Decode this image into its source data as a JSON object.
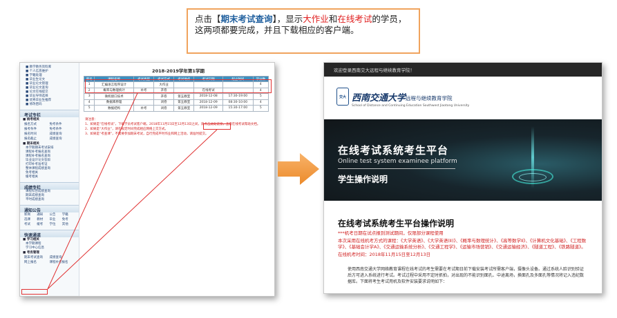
{
  "callout": {
    "pre": "点击【",
    "keyword": "期末考试查询",
    "mid1": "】，显示",
    "red1": "大作业",
    "mid2": "和",
    "red2": "在线考试",
    "post": "的学员，这两项都要完成，并且下载相应的客户端。"
  },
  "left": {
    "sidebar": {
      "top_links": [
        "■ 教学教务资料库",
        "■ 个人信息维护",
        "■ 学籍处理",
        "■ 毕业生论文",
        "■ 毕业论文管理",
        "■ 毕业论文查询",
        "■ 论文在线提交",
        "■ 毕业导师选择",
        "■ 优秀毕业生推荐",
        "■ 修改密码"
      ],
      "exam_head": "考试专栏",
      "exam_sub1": "■ 统考相关",
      "exam_sub1_items": [
        "报名方式",
        "免考条件",
        "报考条件",
        "免考条件",
        "报名时间",
        "成绩查询",
        "报名截止",
        "成绩查询"
      ],
      "exam_sub2": "■ 期末相关",
      "exam_sub2_items": [
        "本学期期末考试安排",
        "课程补考报名查询",
        "课程补考报名查询",
        "毕业设计论文答辩",
        "打印补考准考证",
        "整体课程成绩查询",
        "免考相关",
        "缓考相关"
      ],
      "score_head": "成绩专栏",
      "score_items": [
        "课程综合成绩查询",
        "期末成绩查询",
        "平时成绩查询"
      ],
      "notice_head": "通知公告",
      "notice_items": [
        "新闻",
        "通知",
        "公告",
        "学籍",
        "选课",
        "教材",
        "毕业",
        "免考",
        "考试",
        "缓考",
        "学位",
        "其他"
      ],
      "quick_head": "快速通道",
      "quick_sub1": "■ 学习相关",
      "quick_sub1_items": [
        "本学期课程",
        "学习中心信息"
      ],
      "quick_sub2": "■ 考务管理",
      "quick_sub2_items": [
        "期末考试查询",
        "成绩查询",
        "网上报名",
        "课程补考报名"
      ]
    },
    "table_title": "2018-2019学年第1学期",
    "columns": [
      "序号",
      "课程名称",
      "考试类型",
      "考试方式",
      "考试地点",
      "考试日期",
      "起止时间",
      "学分数"
    ],
    "rows": [
      [
        "1",
        "汇编语言程序设计",
        "",
        "大作业",
        "",
        "",
        "",
        "4"
      ],
      [
        "2",
        "概率与数理统计",
        "补考",
        "开卷",
        "",
        "在线考试",
        "",
        "4"
      ],
      [
        "3",
        "微机接口技术",
        "",
        "开卷",
        "第五教室",
        "2018-12-08",
        "17:30-19:00",
        "5"
      ],
      [
        "4",
        "数据库原理",
        "",
        "闭卷",
        "第五教室",
        "2018-12-09",
        "08:30-10:00",
        "4"
      ],
      [
        "5",
        "数据结构",
        "补考",
        "闭卷",
        "第五教室",
        "2018-12-09",
        "15:30-17:00",
        "5"
      ]
    ],
    "notes": [
      "请注意：",
      "1、如果是“在线考试”，下载学员考试客户端，2018年11月15日至12月13日之间，请点击此处链接，查看在线考试帮助文档。",
      "2、如果是“大作业”，请在规定时间完成相应网络上交方式。",
      "3、如果是“考查课”，不需要参加期末考试，自行完成平时作业和网上活动，请准时提交。"
    ],
    "link_hint": "请点击此处链接"
  },
  "right": {
    "topbar": "欢迎登录西南交大远程与继续教育学院！",
    "seal_text": "交大",
    "brand_cn": "西南交通大学",
    "brand_sub": "远程与继续教育学院",
    "brand_en": "School of Distance and Continuing Education  Southwest Jiaotong University",
    "hero_cn": "在线考试系统考生平台",
    "hero_en": "Online test system examinee platform",
    "hero_sub": "学生操作说明",
    "doc_title": "在线考试系统考生平台操作说明",
    "doc_red": [
      "***机考日期在试点报到测试期间，仅限部分课程使用",
      "本次采用在线机考方式的课程：《大学英语》、《大学英语(Ⅱ)》、《概率与数理统计》、《高等数学Ⅱ》、《计算机文化基础》、《工程数学》、《基础会计学A》、《交通运输系统分析》、《交通工程学》、《运输市场营销》、《交通运输经济》、《隧道工程》、《铁路隧道》。",
      "在线机考时间：2018年11月15日至12月13日"
    ],
    "doc_body": "使用西南交通大学网络教育课程在线考试的考生需要在考试期日前下载安装考试所需客户端，摄像头设备。通过系统人脸识别验证后方可进入系统进行考试。考试过程中采用不定时抓拍，对出现的不能识别面孔、中途离场，换面孔及多面孔等情况将记入违纪数据库。下面将考生考试用机及软件安装要求说明如下："
  }
}
